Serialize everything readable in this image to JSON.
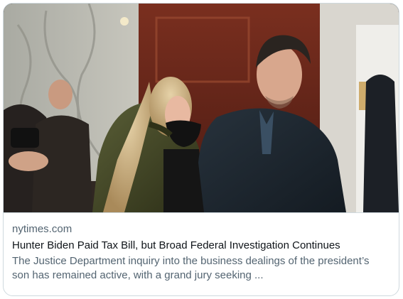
{
  "card": {
    "domain": "nytimes.com",
    "headline": "Hunter Biden Paid Tax Bill, but Broad Federal Investigation Continues",
    "summary": "The Justice Department inquiry into the business dealings of the president’s son has remained active, with a grand jury seeking ..."
  },
  "colors": {
    "border": "#cfd9de",
    "headline": "#0f1419",
    "secondary_text": "#536471",
    "background": "#ffffff"
  }
}
